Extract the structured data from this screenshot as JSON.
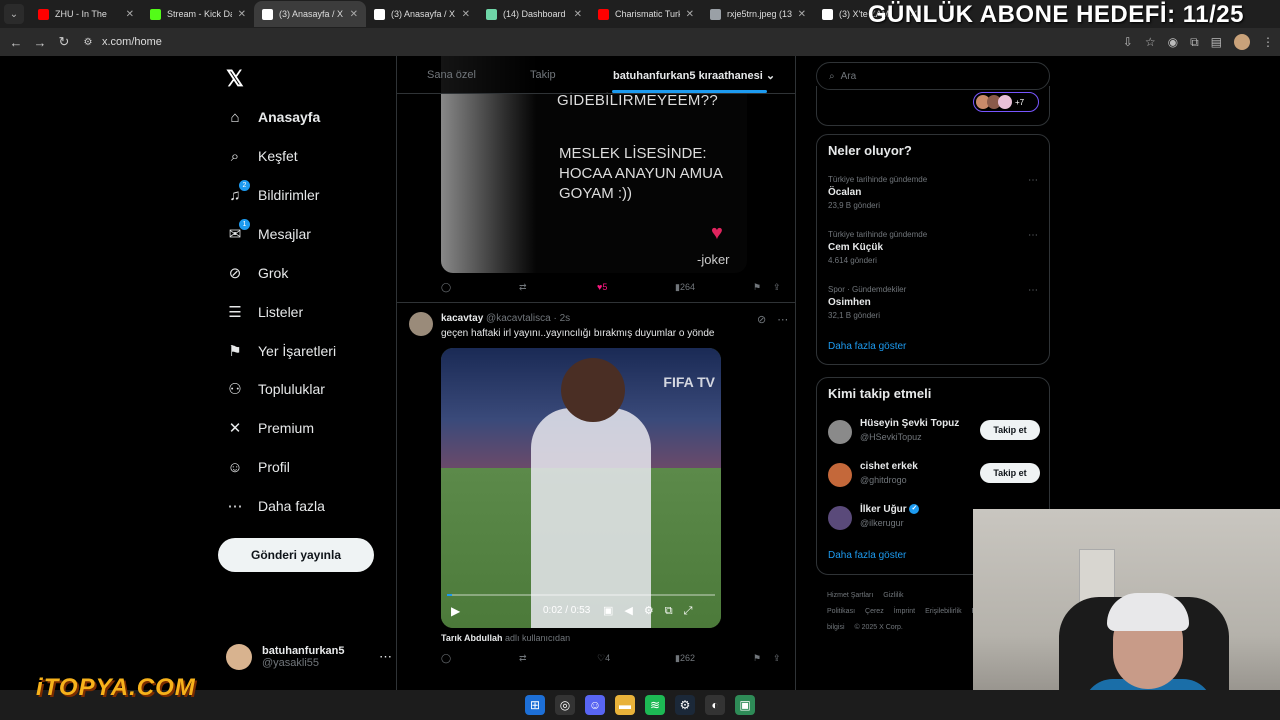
{
  "browser": {
    "tabs": [
      {
        "title": "ZHU - In The",
        "color": "#ff0000"
      },
      {
        "title": "Stream - Kick Das",
        "color": "#53fc18"
      },
      {
        "title": "(3) Anasayfa / X",
        "color": "#ffffff",
        "active": true
      },
      {
        "title": "(3) Anasayfa / X",
        "color": "#ffffff"
      },
      {
        "title": "(14) Dashboard /",
        "color": "#6fd6a8"
      },
      {
        "title": "Charismatic Turkis",
        "color": "#ff0000"
      },
      {
        "title": "rxje5trn.jpeg (132",
        "color": "#9aa0a6"
      },
      {
        "title": "(3) X'te ZAM",
        "color": "#ffffff"
      }
    ],
    "url": "x.com/home"
  },
  "overlay": {
    "goal": "GÜNLÜK ABONE HEDEFİ: 11/25",
    "brand": "iTOPYA.COM"
  },
  "nav": {
    "items": [
      {
        "label": "Anasayfa",
        "icon": "home-icon",
        "glyph": "⌂"
      },
      {
        "label": "Keşfet",
        "icon": "search-icon",
        "glyph": "⌕"
      },
      {
        "label": "Bildirimler",
        "icon": "bell-icon",
        "glyph": "♫",
        "badge": "2"
      },
      {
        "label": "Mesajlar",
        "icon": "mail-icon",
        "glyph": "✉",
        "badge": "1"
      },
      {
        "label": "Grok",
        "icon": "grok-icon",
        "glyph": "⊘"
      },
      {
        "label": "Listeler",
        "icon": "list-icon",
        "glyph": "☰"
      },
      {
        "label": "Yer İşaretleri",
        "icon": "bookmark-icon",
        "glyph": "⚑"
      },
      {
        "label": "Topluluklar",
        "icon": "communities-icon",
        "glyph": "⚇"
      },
      {
        "label": "Premium",
        "icon": "x-logo-icon",
        "glyph": "✕"
      },
      {
        "label": "Profil",
        "icon": "user-icon",
        "glyph": "☺"
      },
      {
        "label": "Daha fazla",
        "icon": "more-circle-icon",
        "glyph": "⋯"
      }
    ],
    "post_button": "Gönderi yayınla",
    "account": {
      "name": "batuhanfurkan5",
      "handle": "@yasakli55"
    }
  },
  "feed": {
    "tabs": [
      "Sana özel",
      "Takip",
      "batuhanfurkan5 kıraathanesi"
    ],
    "tweet1": {
      "media_top": "GİDEBİLİRMEYEEM??",
      "media_text": "MESLEK LİSESİNDE: HOCAA ANAYUN AMUA GOYAM :))",
      "watermark": "-joker",
      "likes": "5",
      "views": "264"
    },
    "tweet2": {
      "author": "kacavtay",
      "handle": "@kacavtalisca",
      "time": "2s",
      "text": "geçen haftaki irl yayını..yayıncılığı bırakmış duyumlar o yönde",
      "video_time": "0:02 / 0:53",
      "video_progress": 0.02,
      "video_logo": "FIFA TV",
      "credit_user": "Tarık Abdullah",
      "credit_suffix": "adlı kullanıcıdan",
      "likes": "4",
      "views": "262"
    }
  },
  "sidebar": {
    "search_placeholder": "Ara",
    "top_card_more": "+7",
    "trends_title": "Neler oluyor?",
    "trends": [
      {
        "context": "Türkiye tarihinde gündemde",
        "name": "Öcalan",
        "count": "23,9 B gönderi"
      },
      {
        "context": "Türkiye tarihinde gündemde",
        "name": "Cem Küçük",
        "count": "4.614 gönderi"
      },
      {
        "context": "Spor · Gündemdekiler",
        "name": "Osimhen",
        "count": "32,1 B gönderi"
      }
    ],
    "show_more": "Daha fazla göster",
    "who_title": "Kimi takip etmeli",
    "who": [
      {
        "name": "Hüseyin Şevki Topuz",
        "handle": "@HSevkiTopuz",
        "button": "Takip et",
        "color": "#8a8a8a"
      },
      {
        "name": "cishet erkek",
        "handle": "@ghitdrogo",
        "button": "Takip et",
        "color": "#c4683a"
      },
      {
        "name": "İlker Uğur",
        "handle": "@ilkerugur",
        "verified": true,
        "color": "#5a4a7a"
      }
    ],
    "footer": [
      "Hizmet Şartları",
      "Gizlilik Politikası",
      "Çerez",
      "İmprint",
      "Erişilebilirlik",
      "Reklam bilgisi",
      "© 2025 X Corp."
    ]
  },
  "colors": {
    "accent": "#1d9bf0",
    "like": "#f91880"
  }
}
